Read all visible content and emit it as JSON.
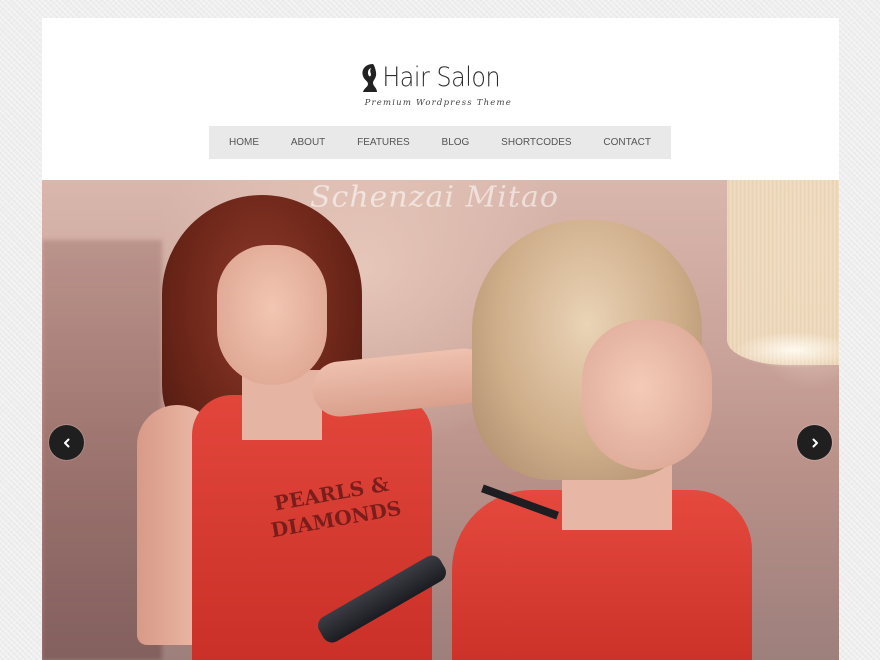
{
  "site": {
    "title": "Hair Salon",
    "tagline": "Premium Wordpress Theme"
  },
  "nav": {
    "items": [
      {
        "label": "HOME"
      },
      {
        "label": "ABOUT"
      },
      {
        "label": "FEATURES"
      },
      {
        "label": "BLOG"
      },
      {
        "label": "SHORTCODES"
      },
      {
        "label": "CONTACT"
      }
    ]
  },
  "slider": {
    "watermark": "Schenzai Mitao",
    "shirt_print": "PEARLS & DIAMONDS",
    "prev_icon": "chevron-left-icon",
    "next_icon": "chevron-right-icon"
  },
  "colors": {
    "background": "#efeeee",
    "nav_bar": "#e9e9e9",
    "nav_text": "#555555",
    "arrow_button": "#1f1f1f"
  }
}
